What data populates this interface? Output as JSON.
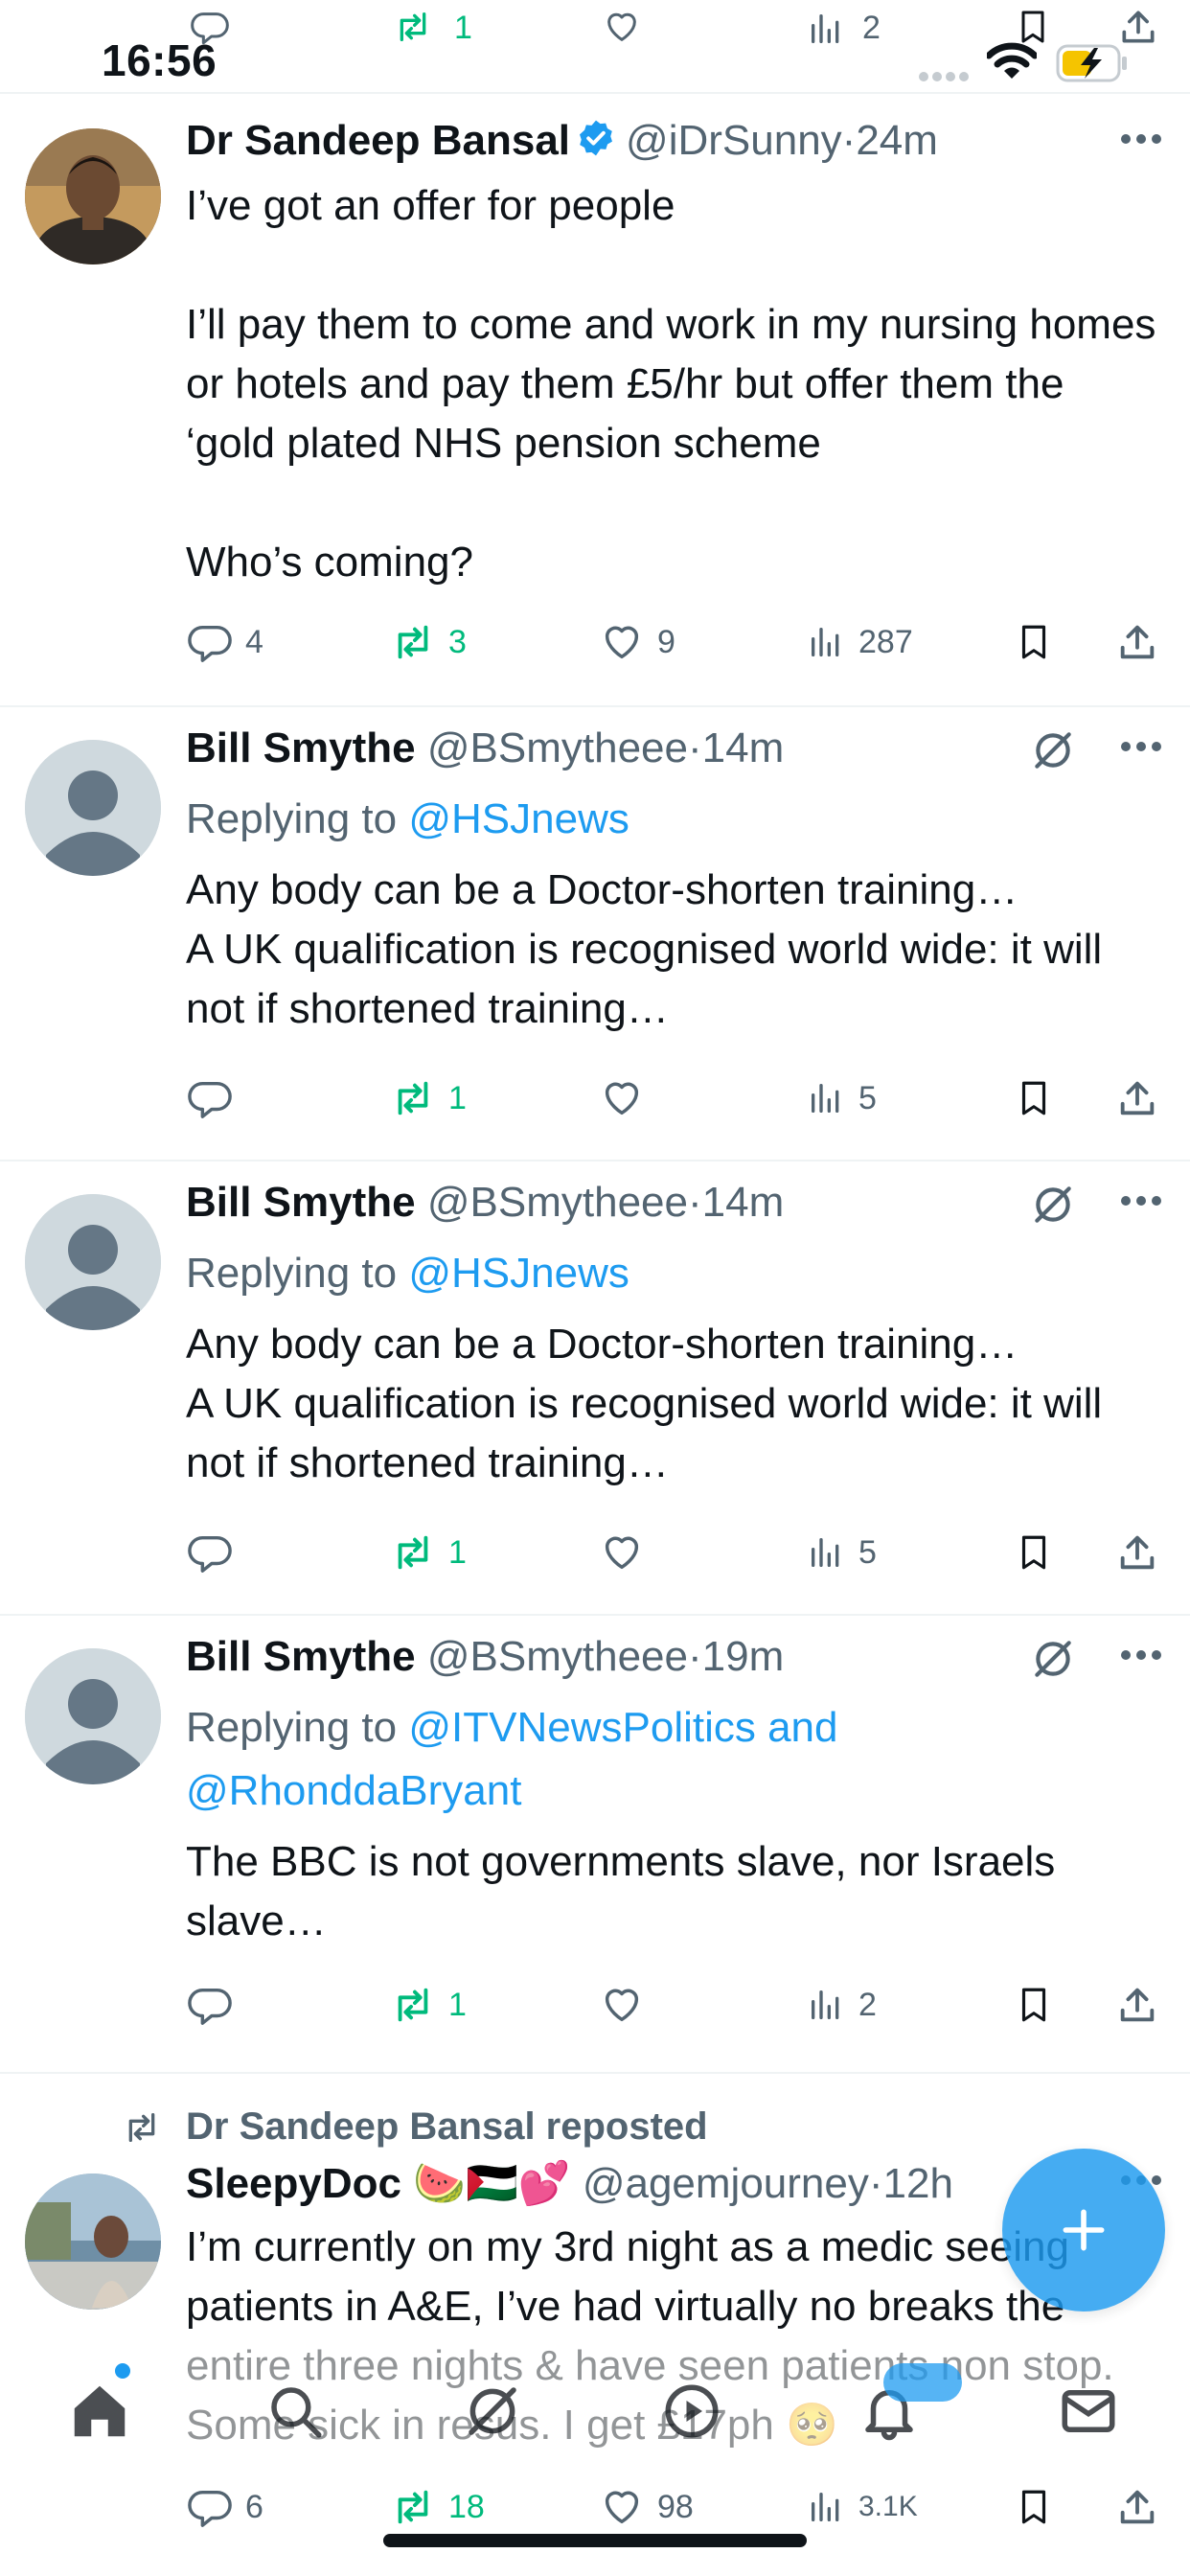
{
  "status_bar": {
    "time": "16:56"
  },
  "top_partial_actions": {
    "retweets": "1",
    "views": "2"
  },
  "tweets": [
    {
      "name": "Dr Sandeep Bansal",
      "handle": "@iDrSunny",
      "time": "24m",
      "verified": true,
      "text": "I’ve got an offer for people\n\nI’ll pay them to come and work in my nursing homes or hotels and pay them £5/hr but offer them the ‘gold plated NHS pension scheme\n\nWho’s coming?",
      "replies": "4",
      "retweets": "3",
      "likes": "9",
      "views": "287"
    },
    {
      "name": "Bill Smythe",
      "handle": "@BSmytheee",
      "time": "14m",
      "replying_prefix": "Replying to ",
      "replying_to": "@HSJnews",
      "text": "Any body can be a Doctor-shorten training…\nA UK qualification is recognised world wide: it will not if shortened training…",
      "replies": "",
      "retweets": "1",
      "likes": "",
      "views": "5"
    },
    {
      "name": "Bill Smythe",
      "handle": "@BSmytheee",
      "time": "14m",
      "replying_prefix": "Replying to ",
      "replying_to": "@HSJnews",
      "text": "Any body can be a Doctor-shorten training…\nA UK qualification is recognised world wide: it will not if shortened training…",
      "replies": "",
      "retweets": "1",
      "likes": "",
      "views": "5"
    },
    {
      "name": "Bill Smythe",
      "handle": "@BSmytheee",
      "time": "19m",
      "replying_prefix": "Replying to ",
      "replying_to": "@ITVNewsPolitics and",
      "replying_to_2": "@RhonddaBryant",
      "text": "The BBC is not governments slave, nor Israels slave…",
      "replies": "",
      "retweets": "1",
      "likes": "",
      "views": "2"
    },
    {
      "repost_label": "Dr Sandeep Bansal reposted",
      "name": "SleepyDoc 🍉🇵🇸💕",
      "handle": "@agemjourney",
      "time": "12h",
      "text": "I’m currently on my 3rd night as a medic seeing patients in A&E, I’ve had virtually no breaks the entire three nights & have seen patients non stop. Some sick in resus. I get £17ph 🥺",
      "replies": "6",
      "retweets": "18",
      "likes": "98",
      "views": "3.1K"
    }
  ],
  "icons": {
    "reply": "reply-icon",
    "retweet": "retweet-icon",
    "like": "heart-icon",
    "views": "views-icon",
    "bookmark": "bookmark-icon",
    "share": "share-icon",
    "more": "more-icon",
    "grok": "grok-icon",
    "verified": "verified-badge-icon"
  },
  "bottom_nav": [
    "home-icon",
    "search-icon",
    "grok-icon",
    "video-icon",
    "notifications-icon",
    "messages-icon"
  ],
  "colors": {
    "accent": "#1d9bf0",
    "retweet": "#00ba7c",
    "muted": "#536471",
    "text": "#0f1419"
  }
}
